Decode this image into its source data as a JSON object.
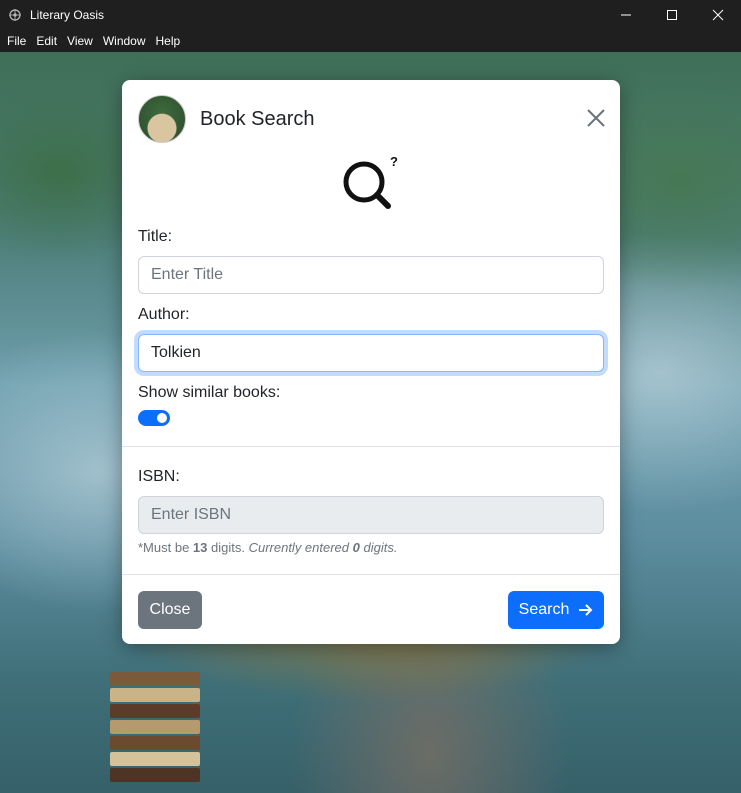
{
  "window": {
    "title": "Literary Oasis",
    "controls": [
      "minimize-icon",
      "maximize-icon",
      "close-icon"
    ]
  },
  "menu": [
    "File",
    "Edit",
    "View",
    "Window",
    "Help"
  ],
  "modal": {
    "title": "Book Search",
    "title_label": "Title:",
    "title_placeholder": "Enter Title",
    "title_value": "",
    "author_label": "Author:",
    "author_value": "Tolkien",
    "similar_label": "Show similar books:",
    "similar_enabled": true,
    "isbn_label": "ISBN:",
    "isbn_placeholder": "Enter ISBN",
    "isbn_value": "",
    "hint": {
      "prefix": "*Must be ",
      "required_digits": "13",
      "mid": " digits. ",
      "current_prefix": "Currently entered ",
      "current_digits": "0",
      "current_suffix": " digits."
    },
    "close_button": "Close",
    "search_button": "Search",
    "question_mark": "?"
  },
  "colors": {
    "primary": "#0d6efd",
    "secondary": "#6c757d",
    "titlebar": "#1f1f1f"
  }
}
